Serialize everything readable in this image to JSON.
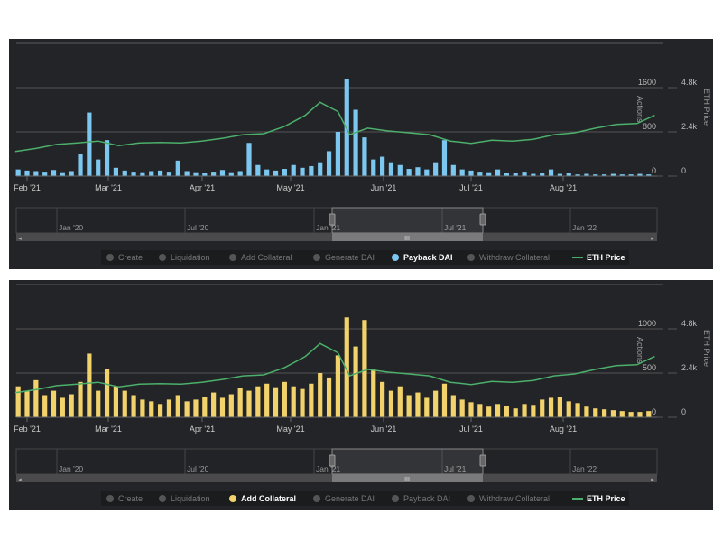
{
  "colors": {
    "background": "#232427",
    "payback": "#7cc7ef",
    "add_collateral": "#f2d26a",
    "eth": "#4caf6b",
    "inactive": "#666666"
  },
  "chart_data": [
    {
      "type": "bar+line",
      "active_series": "Payback DAI",
      "active_color": "#7cc7ef",
      "y_left": {
        "label": "Actions",
        "ticks": [
          "0",
          "800",
          "1600"
        ],
        "range": [
          0,
          1600
        ]
      },
      "y_right": {
        "label": "ETH Price",
        "ticks": [
          "0",
          "2.4k",
          "4.8k"
        ],
        "range": [
          0,
          4800
        ]
      },
      "x_ticks": [
        "Feb '21",
        "Mar '21",
        "Apr '21",
        "May '21",
        "Jun '21",
        "Jul '21",
        "Aug '21"
      ],
      "bar_start": "2021-01-29",
      "bar_interval_days": 3,
      "bar_values": [
        120,
        100,
        90,
        80,
        110,
        70,
        90,
        400,
        1150,
        300,
        650,
        150,
        100,
        80,
        70,
        90,
        100,
        80,
        280,
        90,
        70,
        60,
        80,
        110,
        70,
        90,
        600,
        200,
        120,
        100,
        130,
        200,
        150,
        180,
        250,
        450,
        800,
        1750,
        1200,
        700,
        300,
        350,
        250,
        200,
        130,
        160,
        120,
        250,
        650,
        200,
        120,
        100,
        80,
        70,
        120,
        60,
        50,
        80,
        40,
        60,
        120,
        40,
        50,
        30,
        40,
        30,
        30,
        40,
        30,
        30,
        40,
        30
      ],
      "legend": [
        {
          "label": "Create",
          "active": false
        },
        {
          "label": "Liquidation",
          "active": false
        },
        {
          "label": "Add Collateral",
          "active": false
        },
        {
          "label": "Generate DAI",
          "active": false
        },
        {
          "label": "Payback DAI",
          "active": true
        },
        {
          "label": "Withdraw Collateral",
          "active": false
        },
        {
          "label": "ETH Price",
          "active": true,
          "line": true
        }
      ],
      "navigator_ticks": [
        "Jan '20",
        "Jul '20",
        "Jan '21",
        "Jul '21",
        "Jan '22"
      ]
    },
    {
      "type": "bar+line",
      "active_series": "Add Collateral",
      "active_color": "#f2d26a",
      "y_left": {
        "label": "Actions",
        "ticks": [
          "0",
          "500",
          "1000"
        ],
        "range": [
          0,
          1000
        ]
      },
      "y_right": {
        "label": "ETH Price",
        "ticks": [
          "0",
          "2.4k",
          "4.8k"
        ],
        "range": [
          0,
          4800
        ]
      },
      "x_ticks": [
        "Feb '21",
        "Mar '21",
        "Apr '21",
        "May '21",
        "Jun '21",
        "Jul '21",
        "Aug '21"
      ],
      "bar_start": "2021-01-29",
      "bar_interval_days": 3,
      "bar_values": [
        350,
        300,
        420,
        250,
        300,
        220,
        260,
        400,
        720,
        300,
        550,
        350,
        300,
        250,
        200,
        180,
        150,
        200,
        250,
        180,
        200,
        230,
        280,
        220,
        260,
        330,
        300,
        350,
        380,
        340,
        400,
        350,
        320,
        380,
        500,
        450,
        700,
        1130,
        800,
        1100,
        550,
        400,
        300,
        350,
        250,
        280,
        220,
        300,
        380,
        250,
        200,
        170,
        150,
        120,
        150,
        130,
        100,
        150,
        140,
        200,
        220,
        230,
        180,
        160,
        120,
        100,
        90,
        80,
        70,
        60,
        60,
        70
      ],
      "legend": [
        {
          "label": "Create",
          "active": false
        },
        {
          "label": "Liquidation",
          "active": false
        },
        {
          "label": "Add Collateral",
          "active": true
        },
        {
          "label": "Generate DAI",
          "active": false
        },
        {
          "label": "Payback DAI",
          "active": false
        },
        {
          "label": "Withdraw Collateral",
          "active": false
        },
        {
          "label": "ETH Price",
          "active": true,
          "line": true
        }
      ],
      "navigator_ticks": [
        "Jan '20",
        "Jul '20",
        "Jan '21",
        "Jul '21",
        "Jan '22"
      ]
    }
  ],
  "eth_price": {
    "name": "ETH Price",
    "x": [
      "2021-01-28",
      "2021-02-04",
      "2021-02-11",
      "2021-02-18",
      "2021-02-25",
      "2021-03-04",
      "2021-03-11",
      "2021-03-18",
      "2021-03-25",
      "2021-04-01",
      "2021-04-08",
      "2021-04-15",
      "2021-04-22",
      "2021-04-29",
      "2021-05-06",
      "2021-05-11",
      "2021-05-17",
      "2021-05-21",
      "2021-05-27",
      "2021-06-03",
      "2021-06-10",
      "2021-06-17",
      "2021-06-24",
      "2021-07-01",
      "2021-07-08",
      "2021-07-15",
      "2021-07-22",
      "2021-07-29",
      "2021-08-05",
      "2021-08-12",
      "2021-08-19",
      "2021-08-26",
      "2021-09-01"
    ],
    "y": [
      1330,
      1500,
      1720,
      1800,
      1900,
      1650,
      1800,
      1820,
      1800,
      1900,
      2050,
      2250,
      2300,
      2700,
      3300,
      4000,
      3500,
      2250,
      2600,
      2450,
      2350,
      2250,
      1900,
      1780,
      1950,
      1900,
      2000,
      2250,
      2350,
      2600,
      2800,
      2850,
      3300
    ]
  }
}
